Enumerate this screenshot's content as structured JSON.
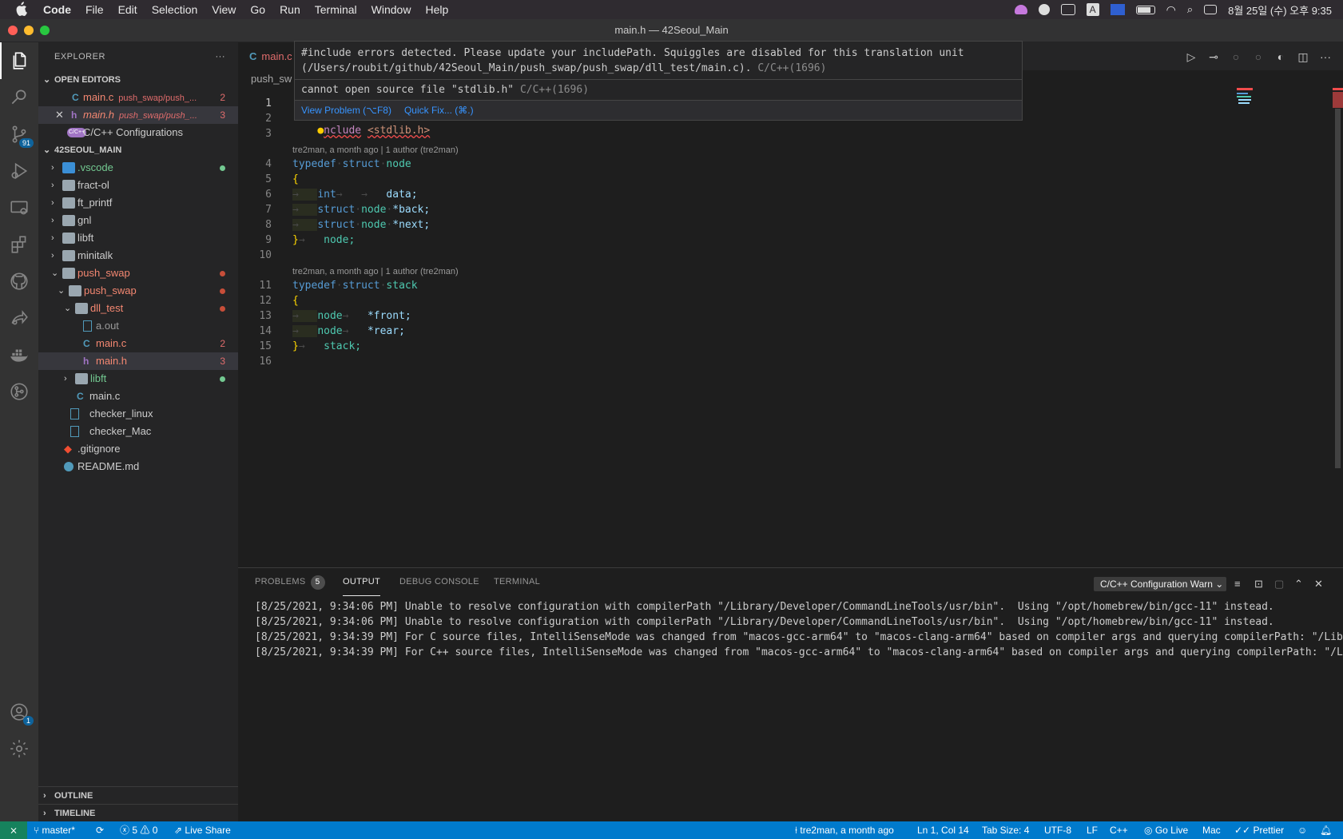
{
  "menubar": {
    "app": "Code",
    "items": [
      "File",
      "Edit",
      "Selection",
      "View",
      "Go",
      "Run",
      "Terminal",
      "Window",
      "Help"
    ],
    "clock": "8월 25일 (수) 오후 9:35"
  },
  "window": {
    "title": "main.h — 42Seoul_Main"
  },
  "activity": {
    "scm_badge": "91",
    "accounts_badge": "1"
  },
  "sidebar": {
    "title": "EXPLORER",
    "open_editors_label": "OPEN EDITORS",
    "open_editors": [
      {
        "icon": "C",
        "name": "main.c",
        "desc": "push_swap/push_...",
        "count": "2"
      },
      {
        "icon": "h",
        "name": "main.h",
        "desc": "push_swap/push_...",
        "count": "3"
      },
      {
        "icon": "C/C++",
        "name": "C/C++ Configurations"
      }
    ],
    "workspace_label": "42SEOUL_MAIN",
    "tree": [
      {
        "name": ".vscode"
      },
      {
        "name": "fract-ol"
      },
      {
        "name": "ft_printf"
      },
      {
        "name": "gnl"
      },
      {
        "name": "libft"
      },
      {
        "name": "minitalk"
      },
      {
        "name": "push_swap"
      },
      {
        "name": "push_swap"
      },
      {
        "name": "dll_test"
      },
      {
        "name": "a.out"
      },
      {
        "name": "main.c",
        "count": "2"
      },
      {
        "name": "main.h",
        "count": "3"
      },
      {
        "name": "libft"
      },
      {
        "name": "main.c"
      },
      {
        "name": "checker_linux"
      },
      {
        "name": "checker_Mac"
      },
      {
        "name": ".gitignore"
      },
      {
        "name": "README.md"
      }
    ],
    "outline_label": "OUTLINE",
    "timeline_label": "TIMELINE"
  },
  "editor": {
    "tab_label": "main.c",
    "breadcrumb": "push_sw",
    "line_numbers": [
      "1",
      "2",
      "3",
      "4",
      "5",
      "6",
      "7",
      "8",
      "9",
      "10",
      "11",
      "12",
      "13",
      "14",
      "15",
      "16"
    ],
    "lens1": "tre2man, a month ago | 1 author (tre2man)",
    "lens2": "tre2man, a month ago | 1 author (tre2man)",
    "code": {
      "l2_dir": "nclude",
      "l2_file": "<stdlib.h>",
      "typedef": "typedef",
      "struct": "struct",
      "node": "node",
      "stack": "stack",
      "int": "int",
      "data": "data;",
      "back": "*back;",
      "next": "*next;",
      "front": "*front;",
      "rear": "*rear;",
      "node_end": "node;",
      "stack_end": "stack;",
      "open_brace": "{",
      "close_brace": "}"
    }
  },
  "hover": {
    "line1": "#include errors detected. Please update your includePath. Squiggles are disabled for this translation unit",
    "line2": "(/Users/roubit/github/42Seoul_Main/push_swap/push_swap/dll_test/main.c).",
    "source1": "C/C++(1696)",
    "line3": "cannot open source file \"stdlib.h\"",
    "source2": "C/C++(1696)",
    "action1": "View Problem (⌥F8)",
    "action2": "Quick Fix... (⌘.)"
  },
  "panel": {
    "tabs": [
      "PROBLEMS",
      "OUTPUT",
      "DEBUG CONSOLE",
      "TERMINAL"
    ],
    "problems_count": "5",
    "channel": "C/C++ Configuration Warn",
    "output": [
      "[8/25/2021, 9:34:06 PM] Unable to resolve configuration with compilerPath \"/Library/Developer/CommandLineTools/usr/bin\".  Using \"/opt/homebrew/bin/gcc-11\" instead.",
      "[8/25/2021, 9:34:06 PM] Unable to resolve configuration with compilerPath \"/Library/Developer/CommandLineTools/usr/bin\".  Using \"/opt/homebrew/bin/gcc-11\" instead.",
      "[8/25/2021, 9:34:39 PM] For C source files, IntelliSenseMode was changed from \"macos-gcc-arm64\" to \"macos-clang-arm64\" based on compiler args and querying compilerPath: \"/Lib",
      "[8/25/2021, 9:34:39 PM] For C++ source files, IntelliSenseMode was changed from \"macos-gcc-arm64\" to \"macos-clang-arm64\" based on compiler args and querying compilerPath: \"/L"
    ]
  },
  "status": {
    "branch": "master*",
    "errors": "5",
    "warnings": "0",
    "live_share": "Live Share",
    "blame": "tre2man, a month ago",
    "position": "Ln 1, Col 14",
    "tab_size": "Tab Size: 4",
    "encoding": "UTF-8",
    "eol": "LF",
    "language": "C++",
    "go_live": "Go Live",
    "platform": "Mac",
    "prettier": "Prettier"
  },
  "colors": {
    "status_bar": "#007acc",
    "remote": "#16825d",
    "error_text": "#f48771",
    "added_text": "#73c991",
    "link": "#3794ff"
  }
}
